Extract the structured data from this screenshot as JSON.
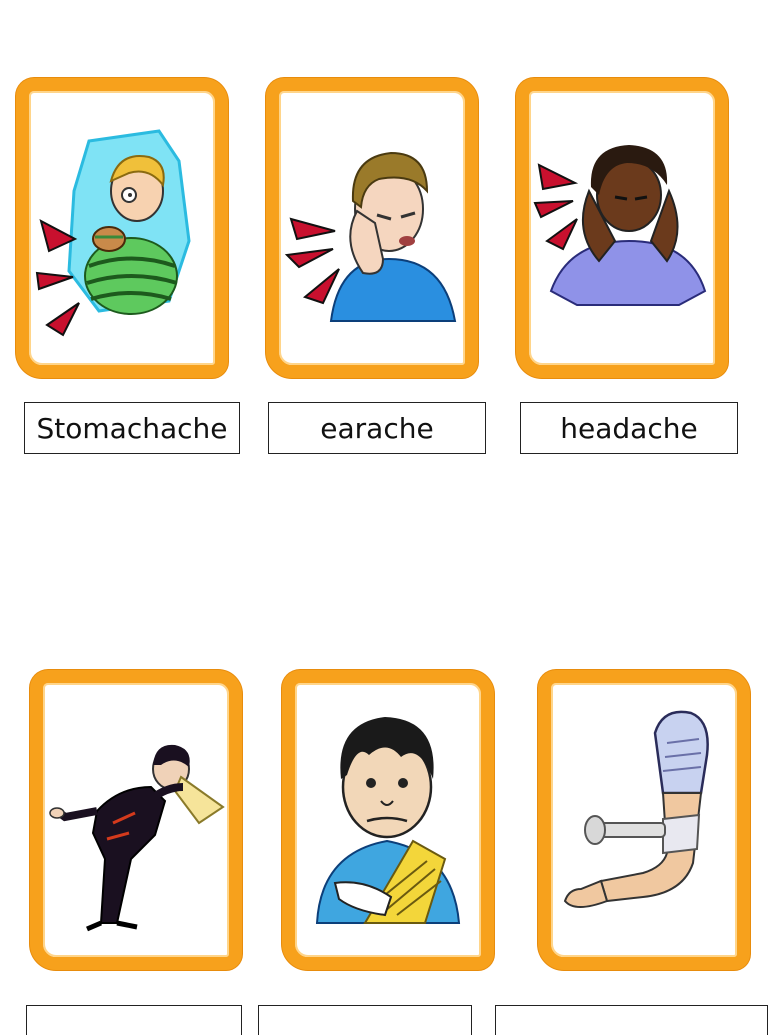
{
  "colors": {
    "frame": "#f7a11c",
    "label_border": "#222222",
    "text": "#111111"
  },
  "cards": [
    {
      "icon": "stomachache-boy-icon",
      "label": "Stomachache"
    },
    {
      "icon": "earache-man-icon",
      "label": "earache"
    },
    {
      "icon": "headache-woman-icon",
      "label": "headache"
    },
    {
      "icon": "sneezing-man-icon"
    },
    {
      "icon": "boy-arm-in-sling-icon"
    },
    {
      "icon": "bandaged-arm-icon"
    }
  ]
}
